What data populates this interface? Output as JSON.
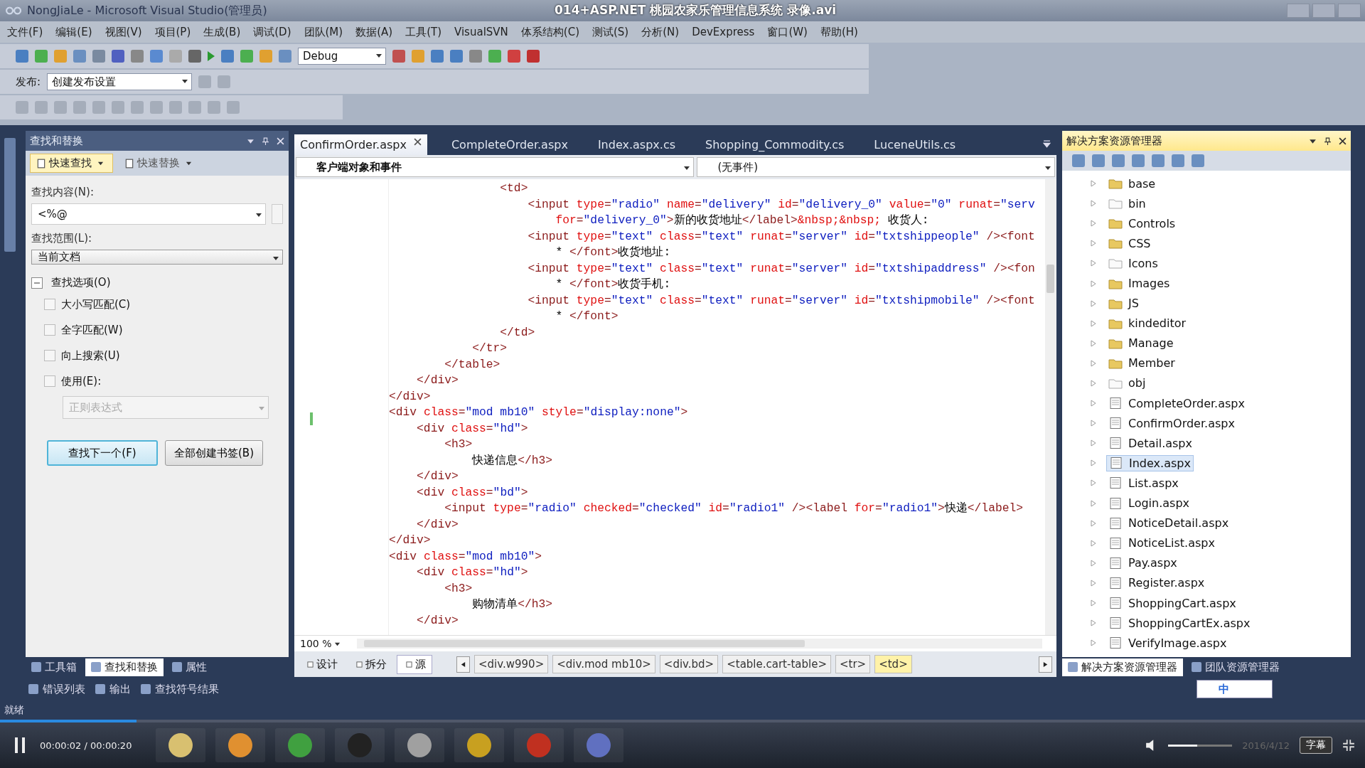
{
  "player": {
    "title": "014+ASP.NET 桃园农家乐管理信息系统 录像.avi",
    "time": "00:00:02 / 00:00:20",
    "progress": {
      "level": 0.1
    },
    "subtitle_button": "字幕",
    "volume": {
      "level": 0.45
    },
    "date": "2016/4/12"
  },
  "window": {
    "title": "NongJiaLe - Microsoft Visual Studio(管理员)"
  },
  "menu": [
    "文件(F)",
    "编辑(E)",
    "视图(V)",
    "项目(P)",
    "生成(B)",
    "调试(D)",
    "团队(M)",
    "数据(A)",
    "工具(T)",
    "VisualSVN",
    "体系结构(C)",
    "测试(S)",
    "分析(N)",
    "DevExpress",
    "窗口(W)",
    "帮助(H)"
  ],
  "toolbar": {
    "configuration": "Debug",
    "publish_label": "发布:",
    "publish_value": "创建发布设置"
  },
  "find_panel": {
    "title": "查找和替换",
    "modes": [
      {
        "label": "快速查找",
        "selected": true
      },
      {
        "label": "快速替换",
        "selected": false
      }
    ],
    "find_label": "查找内容(N):",
    "find_value": "<%@",
    "scope_label": "查找范围(L):",
    "scope_value": "当前文档",
    "options": {
      "label": "查找选项(O)",
      "expanded": true
    },
    "checkboxes": [
      {
        "label": "大小写匹配(C)",
        "checked": false
      },
      {
        "label": "全字匹配(W)",
        "checked": false
      },
      {
        "label": "向上搜索(U)",
        "checked": false
      },
      {
        "label": "使用(E):",
        "checked": false
      }
    ],
    "use_with": {
      "value": "正则表达式",
      "disabled": true
    },
    "buttons": [
      {
        "label": "查找下一个(F)",
        "default": true
      },
      {
        "label": "全部创建书签(B)",
        "default": false
      }
    ]
  },
  "left_tabs": [
    {
      "label": "工具箱",
      "selected": false
    },
    {
      "label": "查找和替换",
      "selected": true
    },
    {
      "label": "属性",
      "selected": false
    }
  ],
  "bottom_tabs": [
    "错误列表",
    "输出",
    "查找符号结果"
  ],
  "status": "就绪",
  "editor": {
    "tabs": [
      {
        "label": "ConfirmOrder.aspx",
        "selected": true
      },
      {
        "label": "CompleteOrder.aspx",
        "selected": false
      },
      {
        "label": "Index.aspx.cs",
        "selected": false
      },
      {
        "label": "Shopping_Commodity.cs",
        "selected": false
      },
      {
        "label": "LuceneUtils.cs",
        "selected": false
      }
    ],
    "object_dropdown": "客户端对象和事件",
    "event_dropdown": "(无事件)",
    "lines": [
      "                <td>",
      "                    <input type=\"radio\" name=\"delivery\" id=\"delivery_0\" value=\"0\" runat=\"serv",
      "                        for=\"delivery_0\">新的收货地址</label>&nbsp;&nbsp; 收货人:",
      "                    <input type=\"text\" class=\"text\" runat=\"server\" id=\"txtshippeople\" /><font",
      "                        * </font>收货地址:",
      "                    <input type=\"text\" class=\"text\" runat=\"server\" id=\"txtshipaddress\" /><fon",
      "                        * </font>收货手机:",
      "                    <input type=\"text\" class=\"text\" runat=\"server\" id=\"txtshipmobile\" /><font",
      "                        * </font>",
      "                </td>",
      "            </tr>",
      "        </table>",
      "    </div>",
      "</div>",
      "<div class=\"mod mb10\" style=\"display:none\">",
      "    <div class=\"hd\">",
      "        <h3>",
      "            快递信息</h3>",
      "    </div>",
      "    <div class=\"bd\">",
      "        <input type=\"radio\" checked=\"checked\" id=\"radio1\" /><label for=\"radio1\">快递</label>",
      "    </div>",
      "</div>",
      "<div class=\"mod mb10\">",
      "    <div class=\"hd\">",
      "        <h3>",
      "            购物清单</h3>",
      "    </div>"
    ],
    "zoom": "100 %",
    "views": [
      {
        "label": "设计",
        "selected": false
      },
      {
        "label": "拆分",
        "selected": false
      },
      {
        "label": "源",
        "selected": true
      }
    ],
    "breadcrumbs": [
      {
        "label": "<div.w990>",
        "selected": false
      },
      {
        "label": "<div.mod mb10>",
        "selected": false
      },
      {
        "label": "<div.bd>",
        "selected": false
      },
      {
        "label": "<table.cart-table>",
        "selected": false
      },
      {
        "label": "<tr>",
        "selected": false
      },
      {
        "label": "<td>",
        "selected": true
      }
    ]
  },
  "solution_explorer": {
    "title": "解决方案资源管理器",
    "items": [
      {
        "label": "base",
        "kind": "folder",
        "selected": false
      },
      {
        "label": "bin",
        "kind": "hidden-folder",
        "selected": false
      },
      {
        "label": "Controls",
        "kind": "folder",
        "selected": false
      },
      {
        "label": "CSS",
        "kind": "folder",
        "selected": false
      },
      {
        "label": "Icons",
        "kind": "hidden-folder",
        "selected": false
      },
      {
        "label": "Images",
        "kind": "folder",
        "selected": false
      },
      {
        "label": "JS",
        "kind": "folder",
        "selected": false
      },
      {
        "label": "kindeditor",
        "kind": "folder",
        "selected": false
      },
      {
        "label": "Manage",
        "kind": "folder",
        "selected": false
      },
      {
        "label": "Member",
        "kind": "folder",
        "selected": false
      },
      {
        "label": "obj",
        "kind": "hidden-folder",
        "selected": false
      },
      {
        "label": "CompleteOrder.aspx",
        "kind": "file",
        "selected": false
      },
      {
        "label": "ConfirmOrder.aspx",
        "kind": "file",
        "selected": false
      },
      {
        "label": "Detail.aspx",
        "kind": "file",
        "selected": false
      },
      {
        "label": "Index.aspx",
        "kind": "file",
        "selected": true
      },
      {
        "label": "List.aspx",
        "kind": "file",
        "selected": false
      },
      {
        "label": "Login.aspx",
        "kind": "file",
        "selected": false
      },
      {
        "label": "NoticeDetail.aspx",
        "kind": "file",
        "selected": false
      },
      {
        "label": "NoticeList.aspx",
        "kind": "file",
        "selected": false
      },
      {
        "label": "Pay.aspx",
        "kind": "file",
        "selected": false
      },
      {
        "label": "Register.aspx",
        "kind": "file",
        "selected": false
      },
      {
        "label": "ShoppingCart.aspx",
        "kind": "file",
        "selected": false
      },
      {
        "label": "ShoppingCartEx.aspx",
        "kind": "file",
        "selected": false
      },
      {
        "label": "VerifyImage.aspx",
        "kind": "file",
        "selected": false
      }
    ],
    "tabs": [
      {
        "label": "解决方案资源管理器",
        "selected": true
      },
      {
        "label": "团队资源管理器",
        "selected": false
      }
    ]
  },
  "ime": {
    "mode": "中"
  }
}
